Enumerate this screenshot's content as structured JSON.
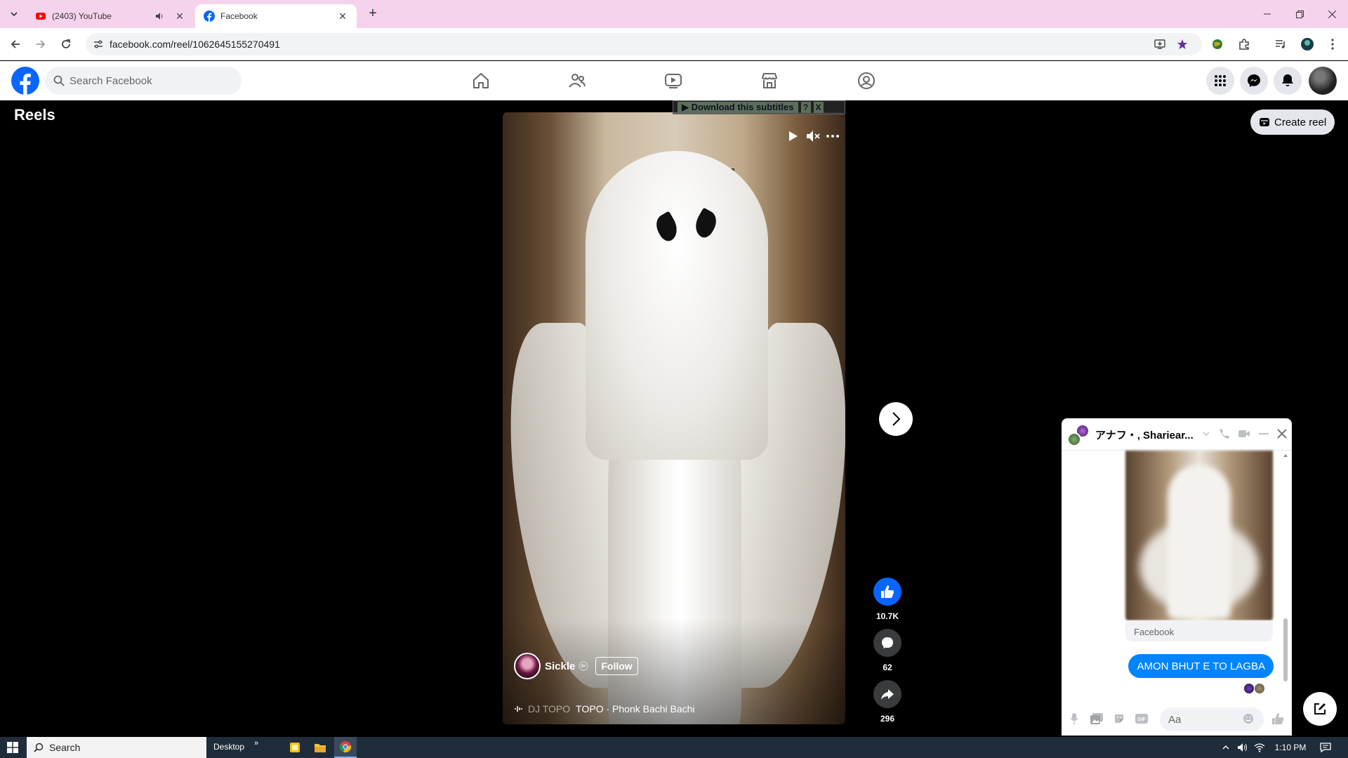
{
  "browser": {
    "tabs": [
      {
        "title": "(2403) YouTube",
        "icon": "youtube-icon",
        "audio": true
      },
      {
        "title": "Facebook",
        "icon": "facebook-icon",
        "active": true
      }
    ],
    "url": "facebook.com/reel/1062645155270491"
  },
  "facebook": {
    "search_placeholder": "Search Facebook",
    "page_title": "Reels",
    "create_reel_label": "Create reel"
  },
  "subtitles_banner": {
    "label": "▶ Download this subtitles",
    "help": "?",
    "close": "X"
  },
  "reel": {
    "creator_name": "Sickle",
    "follow_label": "Follow",
    "audio_prefix": "DJ TOPO",
    "audio_title": "TOPO · Phonk Bachi Bachi",
    "likes": "10.7K",
    "comments": "62",
    "shares": "296"
  },
  "chat": {
    "name": "アナフ・, Shariear...",
    "shared_source": "Facebook",
    "message": "AMON BHUT E TO LAGBA",
    "input_placeholder": "Aa"
  },
  "taskbar": {
    "search_label": "Search",
    "desktop_label": "Desktop",
    "time": "1:10 PM"
  },
  "colors": {
    "facebook_blue": "#0866ff",
    "messenger_bubble": "#0084ff",
    "tabstrip": "#f6d3ec"
  }
}
